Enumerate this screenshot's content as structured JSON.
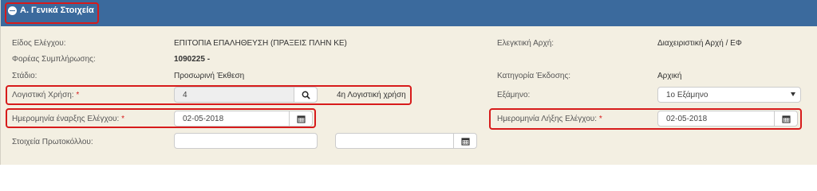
{
  "section": {
    "title": "Α. Γενικά Στοιχεία"
  },
  "fields": {
    "control_type": {
      "label": "Είδος Ελέγχου:",
      "value": "ΕΠΙΤΟΠΙΑ ΕΠΑΛΗΘΕΥΣΗ (ΠΡΑΞΕΙΣ ΠΛΗΝ ΚΕ)"
    },
    "audit_authority": {
      "label": "Ελεγκτική Αρχή:",
      "value": "Διαχειριστική Αρχή / ΕΦ"
    },
    "body": {
      "label": "Φορέας Συμπλήρωσης:",
      "value": "1090225 -"
    },
    "stage": {
      "label": "Στάδιο:",
      "value": "Προσωρινή Έκθεση"
    },
    "issue_category": {
      "label": "Κατηγορία Έκδοσης:",
      "value": "Αρχική"
    },
    "fiscal_year": {
      "label": "Λογιστική Χρήση:",
      "required_mark": "*",
      "value": "4",
      "description": "4η Λογιστική χρήση"
    },
    "semester": {
      "label": "Εξάμηνο:",
      "value": "1ο Εξάμηνο"
    },
    "start_date": {
      "label": "Ημερομηνία έναρξης Ελέγχου:",
      "required_mark": "*",
      "value": "02-05-2018"
    },
    "end_date": {
      "label": "Ημερομηνία Λήξης Ελέγχου:",
      "required_mark": "*",
      "value": "02-05-2018"
    },
    "protocol": {
      "label": "Στοιχεία Πρωτοκόλλου:",
      "number": "",
      "date": ""
    }
  },
  "icons": {
    "collapse": "minus-circle-icon",
    "search": "search-icon",
    "calendar": "calendar-icon",
    "dropdown": "chevron-down-icon"
  },
  "colors": {
    "header": "#3b6a9d",
    "panel": "#f3efe2",
    "highlight": "#d71b1b"
  }
}
